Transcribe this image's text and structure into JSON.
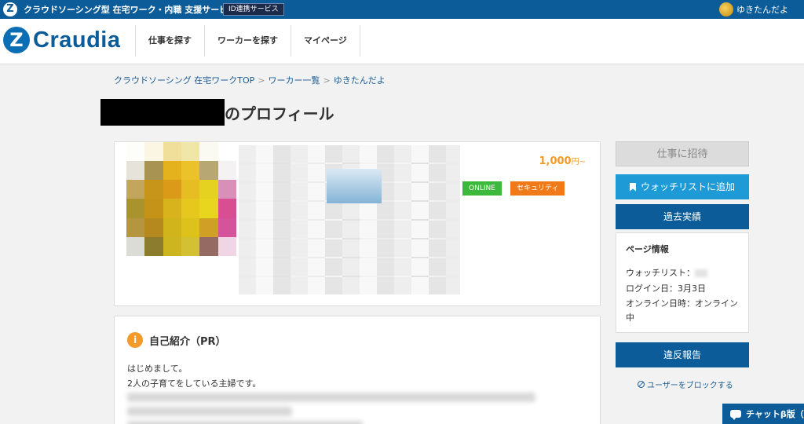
{
  "topbar": {
    "title": "クラウドソーシング型 在宅ワーク・内職 支援サービス",
    "id_badge": "ID連携サービス",
    "username": "ゆきたんだよ"
  },
  "header": {
    "logo_text": "Craudia",
    "nav": [
      "仕事を探す",
      "ワーカーを探す",
      "マイページ"
    ]
  },
  "breadcrumb": {
    "items": [
      "クラウドソーシング 在宅ワークTOP",
      "ワーカー一覧",
      "ゆきたんだよ"
    ],
    "separator": ">"
  },
  "page": {
    "title_suffix": "のプロフィール"
  },
  "profile": {
    "rate": "1,000",
    "rate_unit": "円~",
    "badge_online": "ONLINE",
    "badge_security": "セキュリティ"
  },
  "pr": {
    "icon": "i",
    "title": "自己紹介（PR）",
    "line1": "はじめまして。",
    "line2": "2人の子育てをしている主婦です。"
  },
  "sidebar": {
    "invite_label": "仕事に招待",
    "watch_label": "ウォッチリストに追加",
    "history_label": "過去実績",
    "info_title": "ページ情報",
    "watchlist_label": "ウォッチリスト：",
    "login_label": "ログイン日：3月3日",
    "online_label": "オンライン日時：オンライン",
    "online_cont": "中",
    "report_label": "違反報告",
    "block_label": "ユーザーをブロックする"
  },
  "chat": {
    "label": "チャットβ版（"
  },
  "colors": {
    "brand_blue": "#0b5c99",
    "accent_blue": "#1e9bd7",
    "orange": "#f39a2b",
    "online_green": "#3bb93b",
    "security_orange": "#f07a1a"
  }
}
